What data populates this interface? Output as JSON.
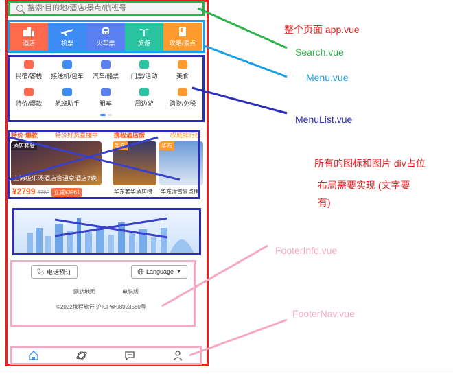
{
  "search": {
    "placeholder": "搜索:目的地/酒店/景点/航班号"
  },
  "menu": {
    "items": [
      {
        "label": "酒店",
        "color": "#ff6a4d",
        "icon": "hotel-icon"
      },
      {
        "label": "机票",
        "color": "#3d8cf5",
        "icon": "plane-icon"
      },
      {
        "label": "火车票",
        "color": "#5a7ff0",
        "icon": "train-icon"
      },
      {
        "label": "旅游",
        "color": "#2ac4a0",
        "icon": "palm-icon"
      },
      {
        "label": "攻略/景点",
        "color": "#ff9a2e",
        "icon": "guide-icon"
      }
    ]
  },
  "menulist": {
    "row1": [
      {
        "label": "民宿/客栈",
        "color": "#ff6a4d"
      },
      {
        "label": "接送机/包车",
        "color": "#3d8cf5"
      },
      {
        "label": "汽车/船票",
        "color": "#5a7ff0"
      },
      {
        "label": "门票/活动",
        "color": "#2ac4a0"
      },
      {
        "label": "美食",
        "color": "#ff9a2e"
      }
    ],
    "row2": [
      {
        "label": "特价/爆款",
        "color": "#ff6a4d"
      },
      {
        "label": "航班助手",
        "color": "#3d8cf5"
      },
      {
        "label": "租车",
        "color": "#5a7ff0"
      },
      {
        "label": "周边游",
        "color": "#2ac4a0"
      },
      {
        "label": "购物/免税",
        "color": "#ff9a2e"
      }
    ]
  },
  "promo": {
    "head1": "特价·爆款",
    "head1b": "特价好货直播中",
    "head2": "携程酒店榜",
    "head2b": "权威排行榜",
    "card1_tag": "酒店套餐",
    "card1_title": "上海极乐汤酒店含温泉酒店2晚",
    "price": "¥2799",
    "oldprice": "6760",
    "cut": "立减¥3961",
    "card2_tag": "华东",
    "card3_tag": "华东",
    "cap2": "华东奢华酒店榜",
    "cap3": "华东滑雪景点榜"
  },
  "footerinfo": {
    "phone": "电话预订",
    "language": "Language",
    "link1": "网站地图",
    "link2": "电脑版",
    "copyright": "©2022携程旅行 沪ICP备08023580号"
  },
  "footernav": {
    "items": [
      {
        "icon": "home-icon"
      },
      {
        "icon": "planet-icon"
      },
      {
        "icon": "message-icon"
      },
      {
        "icon": "user-icon"
      }
    ]
  },
  "annotations": {
    "app": "整个页面 app.vue",
    "search": "Search.vue",
    "menu": "Menu.vue",
    "menulist": "MenuList.vue",
    "note1": "所有的图标和图片 div占位",
    "note2a": "布局需要实现 (文字要",
    "note2b": "有)",
    "footerinfo": "FooterInfo.vue",
    "footernav": "FooterNav.vue",
    "colors": {
      "app": "#e82020",
      "search": "#2cb34a",
      "menu": "#1aa0e6",
      "menulist": "#2b2fb8",
      "footer": "#f7a8c6"
    }
  }
}
